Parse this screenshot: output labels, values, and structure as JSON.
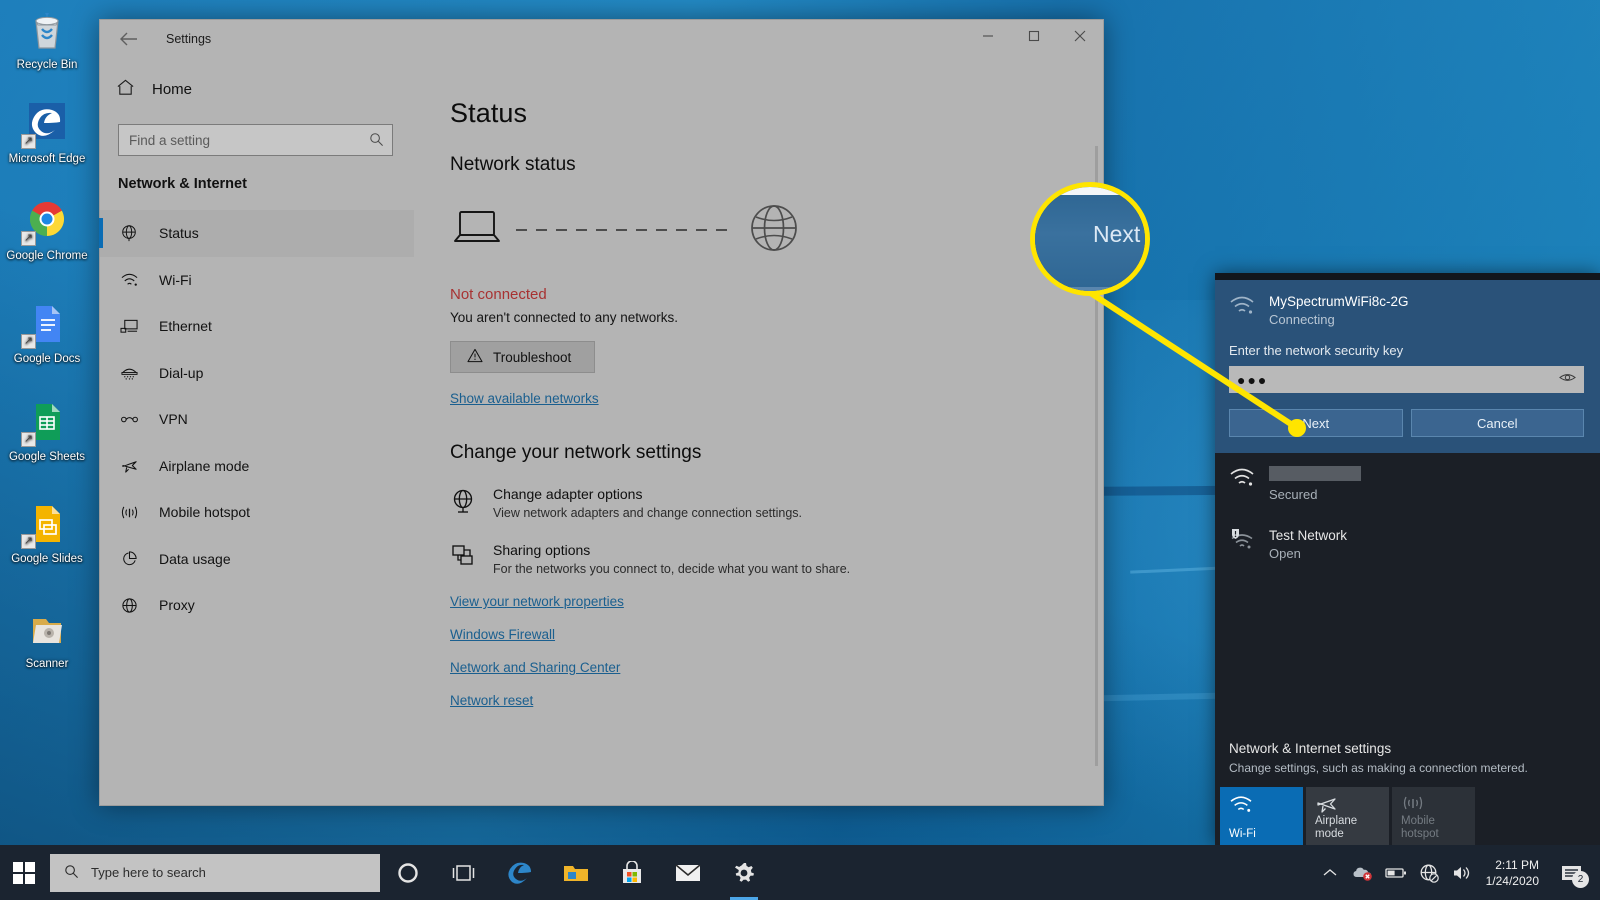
{
  "desktop": {
    "icons": [
      {
        "name": "recycle-bin",
        "label": "Recycle Bin"
      },
      {
        "name": "microsoft-edge",
        "label": "Microsoft Edge"
      },
      {
        "name": "google-chrome",
        "label": "Google Chrome"
      },
      {
        "name": "google-docs",
        "label": "Google Docs"
      },
      {
        "name": "google-sheets",
        "label": "Google Sheets"
      },
      {
        "name": "google-slides",
        "label": "Google Slides"
      },
      {
        "name": "scanner",
        "label": "Scanner"
      }
    ]
  },
  "settings_window": {
    "title": "Settings",
    "back_label": "Back",
    "window_buttons": {
      "minimize": "Minimize",
      "maximize": "Maximize",
      "close": "Close"
    },
    "sidebar": {
      "home_label": "Home",
      "search_placeholder": "Find a setting",
      "search_value": "",
      "section_title": "Network & Internet",
      "items": [
        {
          "label": "Status",
          "icon": "globe-icon",
          "selected": true
        },
        {
          "label": "Wi-Fi",
          "icon": "wifi-icon",
          "selected": false
        },
        {
          "label": "Ethernet",
          "icon": "ethernet-icon",
          "selected": false
        },
        {
          "label": "Dial-up",
          "icon": "dialup-icon",
          "selected": false
        },
        {
          "label": "VPN",
          "icon": "vpn-icon",
          "selected": false
        },
        {
          "label": "Airplane mode",
          "icon": "airplane-icon",
          "selected": false
        },
        {
          "label": "Mobile hotspot",
          "icon": "hotspot-icon",
          "selected": false
        },
        {
          "label": "Data usage",
          "icon": "pie-chart-icon",
          "selected": false
        },
        {
          "label": "Proxy",
          "icon": "proxy-globe-icon",
          "selected": false
        }
      ]
    },
    "content": {
      "page_title": "Status",
      "network_status_heading": "Network status",
      "status_headline": "Not connected",
      "status_headline_color": "#a83232",
      "status_detail": "You aren't connected to any networks.",
      "troubleshoot_label": "Troubleshoot",
      "show_available_networks": "Show available networks",
      "change_settings_heading": "Change your network settings",
      "options": [
        {
          "title": "Change adapter options",
          "desc": "View network adapters and change connection settings.",
          "icon": "adapter-globe-icon"
        },
        {
          "title": "Sharing options",
          "desc": "For the networks you connect to, decide what you want to share.",
          "icon": "sharing-icon"
        }
      ],
      "links": [
        "View your network properties",
        "Windows Firewall",
        "Network and Sharing Center",
        "Network reset"
      ],
      "link_color": "#1a5f8f"
    }
  },
  "wifi_flyout": {
    "connecting": {
      "ssid": "MySpectrumWiFi8c-2G",
      "state": "Connecting",
      "key_label": "Enter the network security key",
      "key_value": "●●●",
      "key_placeholder": "",
      "next_label": "Next",
      "cancel_label": "Cancel"
    },
    "networks": [
      {
        "name": "",
        "redacted": true,
        "security": "Secured",
        "icon": "wifi-icon"
      },
      {
        "name": "Test Network",
        "redacted": false,
        "security": "Open",
        "icon": "wifi-warning-icon"
      }
    ],
    "footer": {
      "title": "Network & Internet settings",
      "desc": "Change settings, such as making a connection metered.",
      "tiles": [
        {
          "label": "Wi-Fi",
          "icon": "wifi-icon",
          "state": "on"
        },
        {
          "label": "Airplane mode",
          "icon": "airplane-icon",
          "state": "off"
        },
        {
          "label": "Mobile hotspot",
          "icon": "hotspot-icon",
          "state": "dim"
        }
      ]
    }
  },
  "callout": {
    "magnified_label": "Next",
    "ring_color": "#ffe500",
    "line_color": "#ffe500"
  },
  "taskbar": {
    "start_label": "Start",
    "search_placeholder": "Type here to search",
    "icons": [
      {
        "name": "cortana-icon",
        "label": "Cortana",
        "active": false
      },
      {
        "name": "task-view-icon",
        "label": "Task View",
        "active": false
      },
      {
        "name": "edge-icon",
        "label": "Microsoft Edge",
        "active": false
      },
      {
        "name": "file-explorer-icon",
        "label": "File Explorer",
        "active": false
      },
      {
        "name": "store-icon",
        "label": "Microsoft Store",
        "active": false
      },
      {
        "name": "mail-icon",
        "label": "Mail",
        "active": false
      },
      {
        "name": "settings-gear-icon",
        "label": "Settings",
        "active": true
      }
    ],
    "tray": {
      "chevron": "show-hidden-icons",
      "onedrive": "onedrive-error-icon",
      "battery": "battery-icon",
      "network": "network-disconnected-icon",
      "volume": "volume-icon",
      "time": "2:11 PM",
      "date": "1/24/2020",
      "notification_count": "2"
    }
  }
}
